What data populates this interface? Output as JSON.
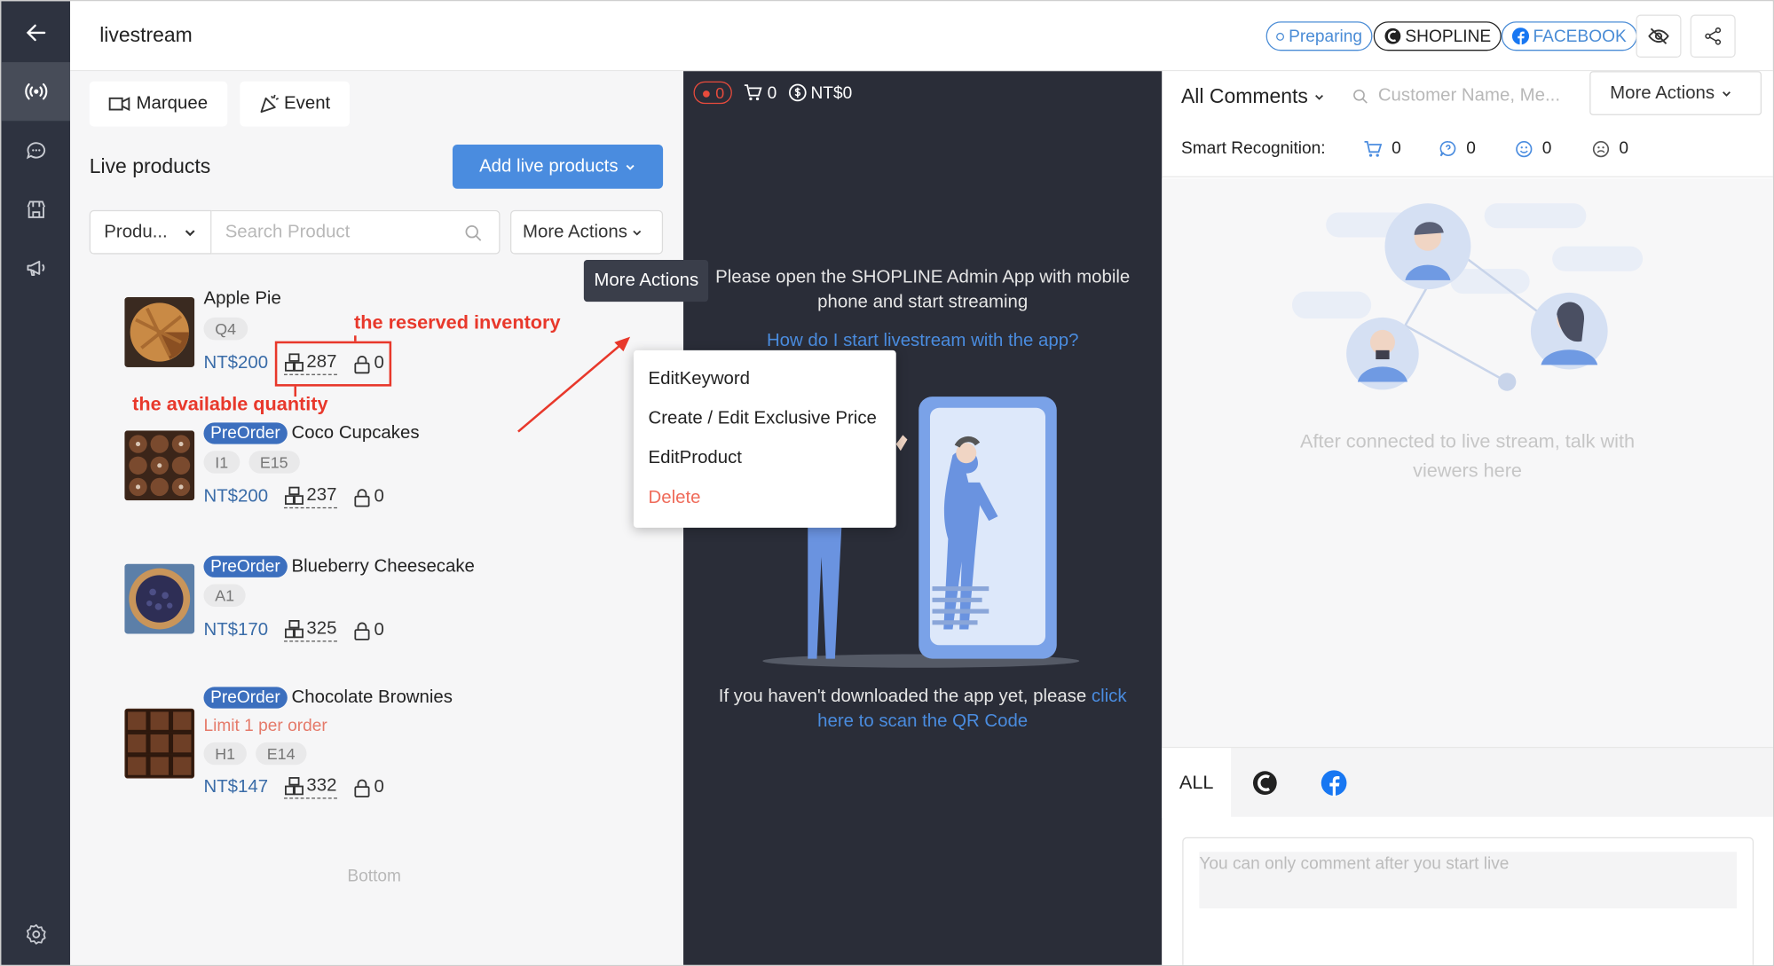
{
  "app": {
    "title": "livestream"
  },
  "header": {
    "status": "Preparing",
    "shopline": "SHOPLINE",
    "facebook": "FACEBOOK"
  },
  "colors": {
    "accent": "#4a8cdf",
    "rail": "#2e3340",
    "dark_panel": "#2a2d38",
    "danger": "#ef6b5a",
    "annotation": "#e8382b"
  },
  "rail": [
    "back-arrow-icon",
    "live-broadcast-icon",
    "chat-icon",
    "store-icon",
    "megaphone-icon",
    "settings-icon"
  ],
  "left": {
    "marquee": "Marquee",
    "event": "Event",
    "section_title": "Live products",
    "add_button": "Add live products",
    "filter_select": "Produ...",
    "search_placeholder": "Search Product",
    "more_actions": "More Actions",
    "bottom": "Bottom",
    "products": [
      {
        "badge": "",
        "name": "Apple Pie",
        "limit": "",
        "tags": [
          "Q4"
        ],
        "price": "NT$200",
        "stock": "287",
        "reserved": "0"
      },
      {
        "badge": "PreOrder",
        "name": "Coco Cupcakes",
        "limit": "",
        "tags": [
          "I1",
          "E15"
        ],
        "price": "NT$200",
        "stock": "237",
        "reserved": "0"
      },
      {
        "badge": "PreOrder",
        "name": "Blueberry Cheesecake",
        "limit": "",
        "tags": [
          "A1"
        ],
        "price": "NT$170",
        "stock": "325",
        "reserved": "0"
      },
      {
        "badge": "PreOrder",
        "name": "Chocolate Brownies",
        "limit": "Limit 1 per order",
        "tags": [
          "H1",
          "E14"
        ],
        "price": "NT$147",
        "stock": "332",
        "reserved": "0"
      }
    ]
  },
  "annotations": {
    "reserved": "the reserved inventory",
    "available": "the available quantity"
  },
  "tooltip": "More Actions",
  "menu": [
    "EditKeyword",
    "Create / Edit Exclusive Price",
    "EditProduct",
    "Delete"
  ],
  "middle": {
    "rec_count": "0",
    "cart_count": "0",
    "revenue": "NT$0",
    "message": "Please open the SHOPLINE Admin App with mobile phone and start streaming",
    "help_link": "How do I start livestream with the app?",
    "footer_text": "If you haven't downloaded the app yet, please",
    "footer_link": "click here to scan the QR Code"
  },
  "right": {
    "comments_filter": "All Comments",
    "search_placeholder": "Customer Name, Me...",
    "more_actions": "More Actions",
    "smart_label": "Smart Recognition:",
    "smart_counts": [
      "0",
      "0",
      "0",
      "0"
    ],
    "empty_text": "After connected to live stream, talk with viewers here",
    "tab_all": "ALL",
    "composer_placeholder": "You can only comment after you start live"
  }
}
